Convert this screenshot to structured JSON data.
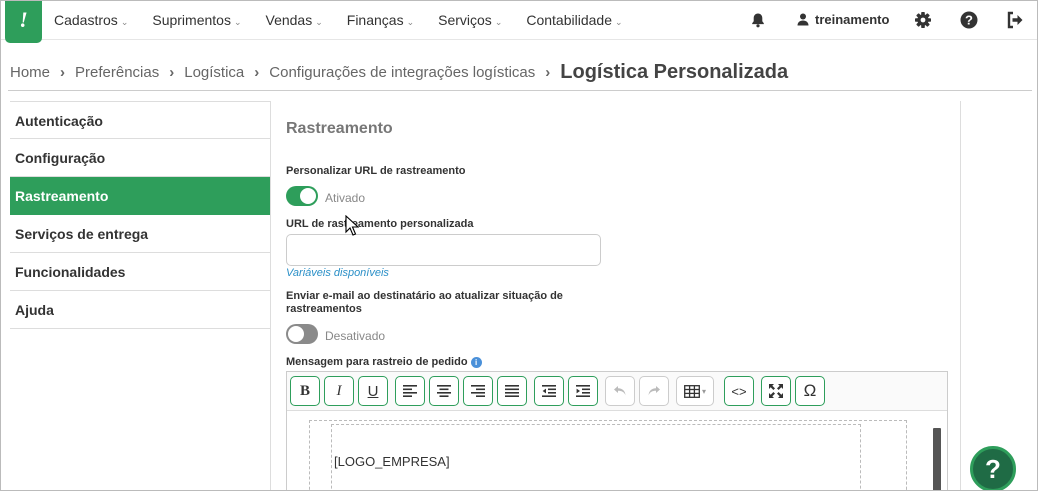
{
  "app": {
    "logo_glyph": "!",
    "brand_color": "#2e9e5b"
  },
  "nav": {
    "items": [
      {
        "label": "Cadastros"
      },
      {
        "label": "Suprimentos"
      },
      {
        "label": "Vendas"
      },
      {
        "label": "Finanças"
      },
      {
        "label": "Serviços"
      },
      {
        "label": "Contabilidade"
      }
    ],
    "user": "treinamento",
    "icons": [
      "bell-icon",
      "user-icon",
      "gear-icon",
      "help-icon",
      "logout-icon"
    ]
  },
  "breadcrumb": {
    "items": [
      "Home",
      "Preferências",
      "Logística",
      "Configurações de integrações logísticas"
    ],
    "current": "Logística Personalizada"
  },
  "sidemenu": {
    "items": [
      {
        "label": "Autenticação",
        "active": false
      },
      {
        "label": "Configuração",
        "active": false
      },
      {
        "label": "Rastreamento",
        "active": true
      },
      {
        "label": "Serviços de entrega",
        "active": false
      },
      {
        "label": "Funcionalidades",
        "active": false
      },
      {
        "label": "Ajuda",
        "active": false
      }
    ]
  },
  "content": {
    "section_title": "Rastreamento",
    "custom_url_label": "Personalizar URL de rastreamento",
    "custom_url_toggle": {
      "state": "on",
      "text": "Ativado"
    },
    "url_field_label": "URL de rastreamento personalizada",
    "url_field_value": "",
    "variables_link": "Variáveis disponíveis",
    "email_label": "Enviar e-mail ao destinatário ao atualizar situação de rastreamentos",
    "email_toggle": {
      "state": "off",
      "text": "Desativado"
    },
    "message_label": "Mensagem para rastreio de pedido",
    "editor_content": "[LOGO_EMPRESA]"
  },
  "help_button": "?"
}
